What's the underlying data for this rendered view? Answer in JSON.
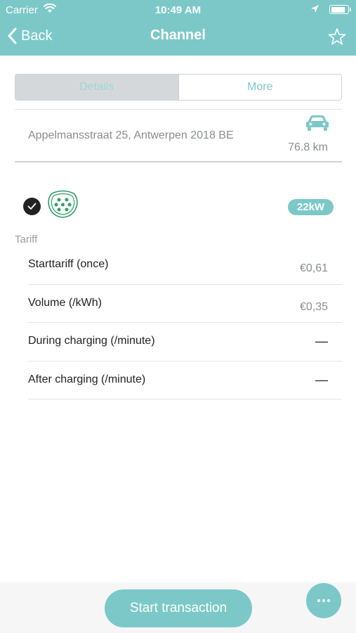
{
  "status_bar": {
    "carrier": "Carrier",
    "time": "10:49 AM",
    "battery_level": 0.85
  },
  "nav": {
    "back_label": "Back",
    "title": "Channel"
  },
  "tabs": [
    {
      "label": "Details",
      "active": true
    },
    {
      "label": "More",
      "active": false
    }
  ],
  "location": {
    "address": "Appelmansstraat 25, Antwerpen 2018 BE",
    "distance": "76.8 km"
  },
  "connector": {
    "power": "22kW",
    "selected": true
  },
  "tariff": {
    "label": "Tariff",
    "rows": [
      {
        "label": "Starttariff (once)",
        "value": "€0,61"
      },
      {
        "label": "Volume (/kWh)",
        "value": "€0,35"
      },
      {
        "label": "During charging (/minute)",
        "value": "—"
      },
      {
        "label": "After charging (/minute)",
        "value": "—"
      }
    ]
  },
  "actions": {
    "start_label": "Start transaction"
  },
  "colors": {
    "accent": "#7cc8c8",
    "plug_green": "#2f9e67"
  }
}
